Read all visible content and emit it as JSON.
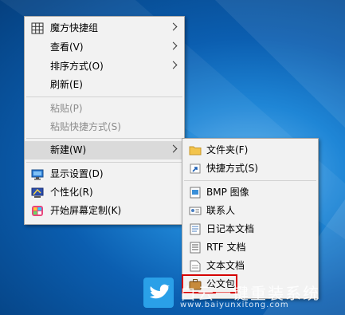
{
  "context_menu": {
    "items": [
      {
        "label": "魔方快捷组",
        "icon": "grid-icon",
        "has_submenu": true,
        "enabled": true
      },
      {
        "label": "查看(V)",
        "has_submenu": true,
        "enabled": true
      },
      {
        "label": "排序方式(O)",
        "has_submenu": true,
        "enabled": true
      },
      {
        "label": "刷新(E)",
        "enabled": true
      },
      {
        "label": "粘贴(P)",
        "enabled": false
      },
      {
        "label": "粘贴快捷方式(S)",
        "enabled": false
      },
      {
        "label": "新建(W)",
        "has_submenu": true,
        "enabled": true,
        "highlighted": true
      },
      {
        "label": "显示设置(D)",
        "icon": "display-settings-icon",
        "enabled": true
      },
      {
        "label": "个性化(R)",
        "icon": "personalize-icon",
        "enabled": true
      },
      {
        "label": "开始屏幕定制(K)",
        "icon": "start-screen-icon",
        "enabled": true
      }
    ]
  },
  "new_submenu": {
    "items": [
      {
        "label": "文件夹(F)",
        "icon": "folder-icon"
      },
      {
        "label": "快捷方式(S)",
        "icon": "shortcut-icon"
      },
      {
        "label": "BMP 图像",
        "icon": "bmp-image-icon"
      },
      {
        "label": "联系人",
        "icon": "contact-icon"
      },
      {
        "label": "日记本文档",
        "icon": "journal-icon"
      },
      {
        "label": "RTF 文档",
        "icon": "rtf-document-icon"
      },
      {
        "label": "文本文档",
        "icon": "text-document-icon"
      },
      {
        "label": "公文包",
        "icon": "briefcase-icon",
        "outlined": true
      }
    ]
  },
  "watermark": {
    "brand": "白云一键重装系统",
    "url": "www.baiyunxitong.com",
    "icon": "bird-logo-icon"
  },
  "colors": {
    "highlight_outline": "#d50000",
    "menu_background": "#f2f2f2",
    "hover_background": "#dadada",
    "desktop_blue": "#0b5eb0"
  }
}
